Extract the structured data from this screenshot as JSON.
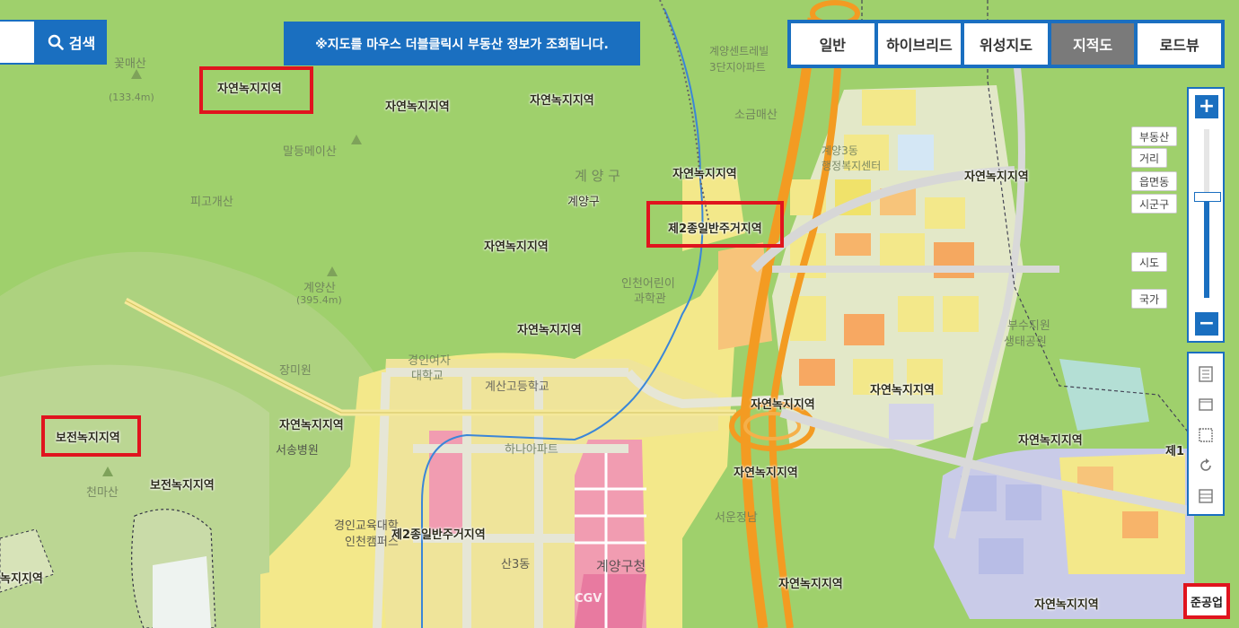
{
  "search": {
    "button_label": "검색",
    "icon": "search-icon"
  },
  "notice": "※지도를 마우스 더블클릭시 부동산 정보가 조회됩니다.",
  "map_types": [
    {
      "label": "일반",
      "active": false
    },
    {
      "label": "하이브리드",
      "active": false
    },
    {
      "label": "위성지도",
      "active": false
    },
    {
      "label": "지적도",
      "active": true
    },
    {
      "label": "로드뷰",
      "active": false
    }
  ],
  "zoom": {
    "plus": "+",
    "minus": "−",
    "level_fraction": 0.6,
    "levels": [
      "부동산",
      "거리",
      "읍면동",
      "시군구",
      "시도",
      "국가"
    ]
  },
  "tools": [
    "ruler-icon",
    "area-icon",
    "rectangle-icon",
    "refresh-icon",
    "list-icon"
  ],
  "zone_labels": {
    "z1": "자연녹지지역",
    "z2": "자연녹지지역",
    "z3": "자연녹지지역",
    "z4": "자연녹지지역",
    "z5": "자연녹지지역",
    "z6": "자연녹지지역",
    "z7": "자연녹지지역",
    "z8": "자연녹지지역",
    "z9": "자연녹지지역",
    "z10": "자연녹지지역",
    "z11": "자연녹지지역",
    "z12": "자연녹지지역",
    "z13": "자연녹지지역",
    "z14": "자연녹지지역",
    "r1": "제2종일반주거지역",
    "r2": "제2종일반주거지역",
    "p1": "보전녹지지역",
    "p2": "보전녹지지역",
    "partial_left": "녹지지역",
    "partial_right": "제1"
  },
  "place_labels": {
    "kkomae": "꽃매산",
    "kkomae_h": "(133.4m)",
    "maldeung": "말등메이산",
    "pigo": "피고개산",
    "gyeyang_gu_big": "계 양 구",
    "gyeyang_gu": "계양구",
    "gyeyang_san": "계양산",
    "gyeyang_h": "(395.4m)",
    "jangmi": "장미원",
    "seosong": "서송병원",
    "cheonma": "천마산",
    "sogeum": "소금매산",
    "gyeyang3": "계양3동",
    "gyeyang3b": "행정복지센터",
    "children": "인천어린이",
    "children2": "과학관",
    "uni": "경인여자",
    "uni2": "대학교",
    "school": "계산고등학교",
    "hana": "하나아파트",
    "gyeyang_office": "계양구청",
    "apt1": "계양센트레빌",
    "apt2": "3단지아파트",
    "gyeongin": "경인교육대학",
    "gyeongin2": "인천캠퍼스",
    "sancheon": "산3동",
    "bujang": "부수지원",
    "bujang2": "생태공원",
    "cgv": "CGV",
    "seowon": "서운정남"
  },
  "bottom_right": "준공업"
}
